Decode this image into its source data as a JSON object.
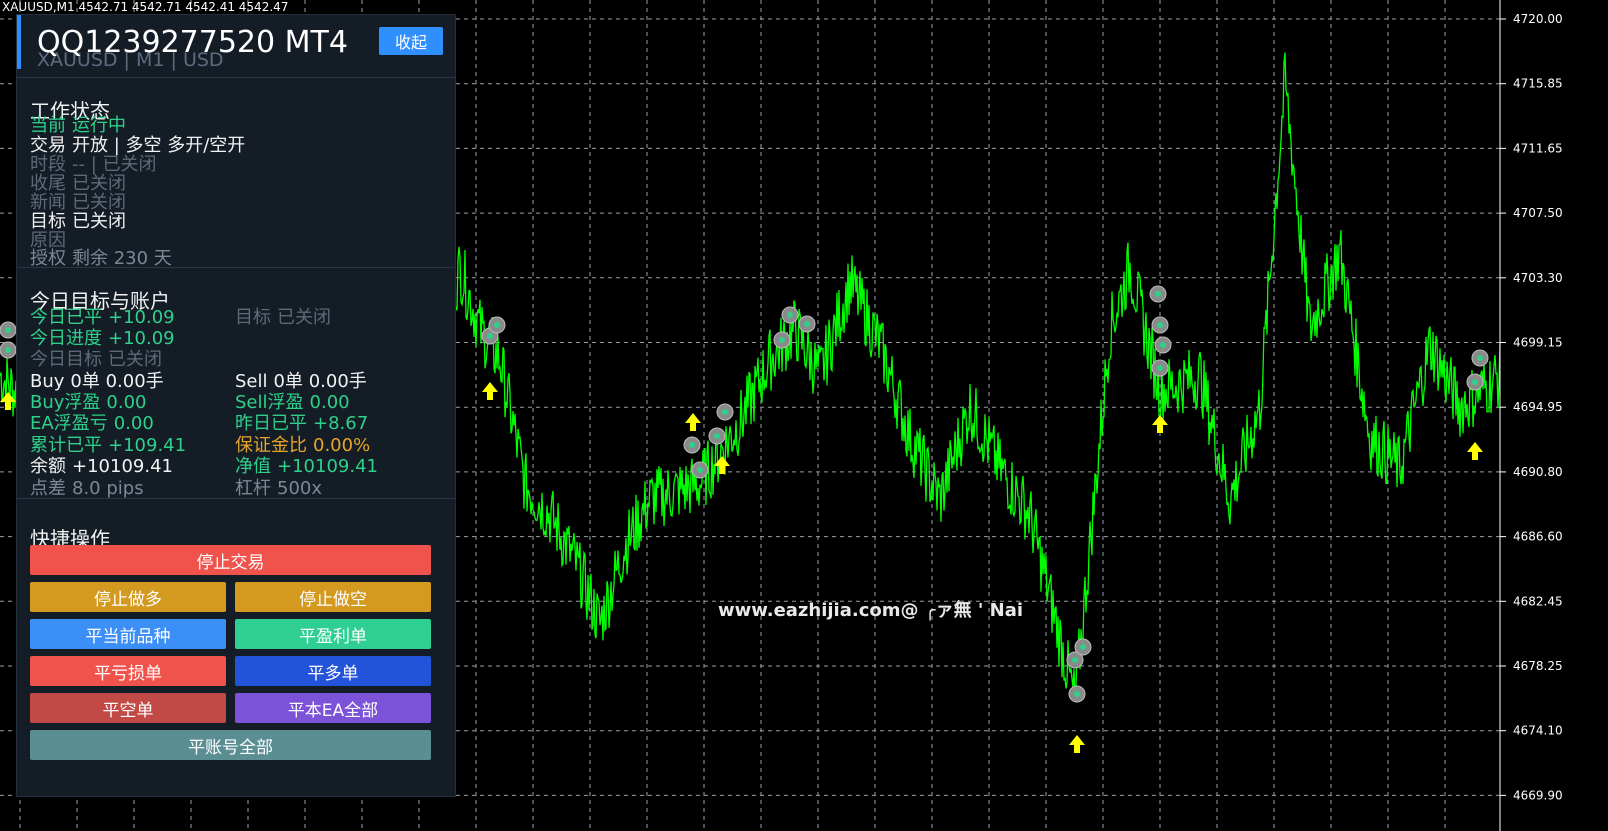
{
  "chart": {
    "symbol_line": "XAUUSD,M1  4542.71 4542.71 4542.41 4542.47",
    "price_labels": [
      "4720.00",
      "4715.85",
      "4711.65",
      "4707.50",
      "4703.30",
      "4699.15",
      "4694.95",
      "4690.80",
      "4686.60",
      "4682.45",
      "4678.25",
      "4674.10",
      "4669.90"
    ],
    "watermark": "www.eazhijia.com@ ╭ァ無 ' Nai",
    "line_color": "#00ff00",
    "grid_color": "#9aa0a8",
    "arrow_color": "#ffff00"
  },
  "panel": {
    "title": "QQ1239277520 MT4",
    "subtitle": "XAUUSD | M1 | USD",
    "collapse_label": "收起",
    "status": {
      "heading": "工作状态",
      "current": {
        "label": "当前",
        "value": "运行中"
      },
      "trade": {
        "label": "交易",
        "value": "开放 | 多空  多开/空开"
      },
      "session": {
        "label": "时段",
        "value": "-- | 已关闭"
      },
      "closing": {
        "label": "收尾",
        "value": "已关闭"
      },
      "news": {
        "label": "新闻",
        "value": "已关闭"
      },
      "target": {
        "label": "目标",
        "value": "已关闭"
      },
      "reason": {
        "label": "原因",
        "value": ""
      },
      "license": {
        "label": "授权",
        "value": "剩余 230 天"
      }
    },
    "account": {
      "heading": "今日目标与账户",
      "today_closed": {
        "label": "今日已平",
        "value": "+10.09"
      },
      "goal": {
        "label": "目标",
        "value": "已关闭"
      },
      "today_progress": {
        "label": "今日进度",
        "value": "+10.09"
      },
      "today_target": {
        "label": "今日目标",
        "value": "已关闭"
      },
      "buy": {
        "label": "Buy",
        "value": "0单  0.00手"
      },
      "sell": {
        "label": "Sell",
        "value": "0单  0.00手"
      },
      "buy_float": {
        "label": "Buy浮盈",
        "value": "0.00"
      },
      "sell_float": {
        "label": "Sell浮盈",
        "value": "0.00"
      },
      "ea_float": {
        "label": "EA浮盈亏",
        "value": "0.00"
      },
      "yesterday": {
        "label": "昨日已平",
        "value": "+8.67"
      },
      "total_closed": {
        "label": "累计已平",
        "value": "+109.41"
      },
      "margin_ratio": {
        "label": "保证金比",
        "value": "0.00%"
      },
      "balance": {
        "label": "余额",
        "value": "+10109.41"
      },
      "equity": {
        "label": "净值",
        "value": "+10109.41"
      },
      "spread": {
        "label": "点差",
        "value": "8.0 pips"
      },
      "leverage": {
        "label": "杠杆",
        "value": "500x"
      }
    },
    "actions": {
      "heading": "快捷操作",
      "stop_trading": "停止交易",
      "stop_long": "停止做多",
      "stop_short": "停止做空",
      "close_symbol": "平当前品种",
      "close_profit": "平盈利单",
      "close_loss": "平亏损单",
      "close_buy": "平多单",
      "close_sell": "平空单",
      "close_ea_all": "平本EA全部",
      "close_account_all": "平账号全部"
    },
    "colors": {
      "accent": "#2f8fff",
      "positive": "#2ed08a",
      "warning": "#e5a52a",
      "stop_trading": "#f0534b",
      "stop_long": "#d4991f",
      "stop_short": "#d4991f",
      "close_symbol": "#3b8ff7",
      "close_profit": "#2fcf93",
      "close_loss": "#f0534b",
      "close_buy": "#2353d9",
      "close_sell": "#c14a47",
      "close_ea_all": "#7b52d8",
      "close_account_all": "#5a8e93"
    }
  }
}
